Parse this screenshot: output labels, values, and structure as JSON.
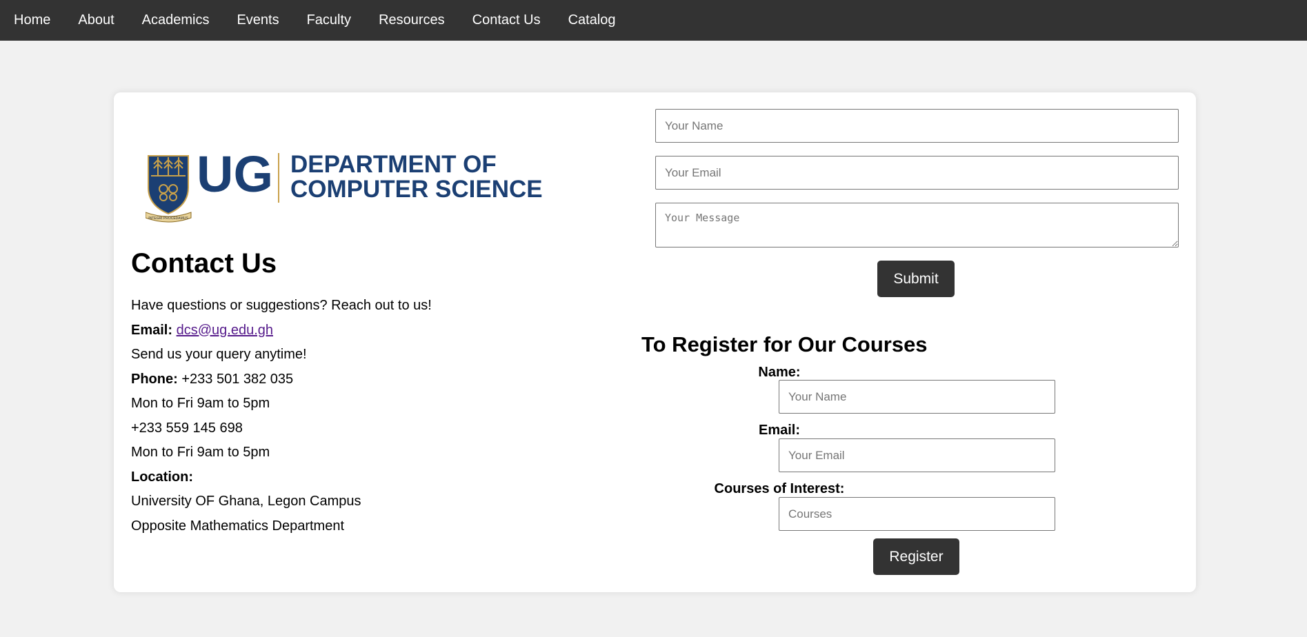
{
  "nav": {
    "items": [
      "Home",
      "About",
      "Academics",
      "Events",
      "Faculty",
      "Resources",
      "Contact Us",
      "Catalog"
    ]
  },
  "logo": {
    "mark": "UG",
    "line1": "DEPARTMENT OF",
    "line2": "COMPUTER SCIENCE",
    "motto": "INTEGRI PROCEDAMUS",
    "brand_color": "#1b3f73",
    "gold_color": "#c9a14a"
  },
  "contact": {
    "title": "Contact Us",
    "intro": "Have questions or suggestions? Reach out to us!",
    "email_label": "Email:",
    "email": "dcs@ug.edu.gh",
    "query": "Send us your query anytime!",
    "phone_label": "Phone:",
    "phone1": "+233 501 382 035",
    "hours1": "Mon to Fri 9am to 5pm",
    "phone2": "+233 559 145 698",
    "hours2": "Mon to Fri 9am to 5pm",
    "location_label": "Location:",
    "location1": "University OF Ghana, Legon Campus",
    "location2": "Opposite Mathematics Department"
  },
  "contact_form": {
    "name_placeholder": "Your Name",
    "email_placeholder": "Your Email",
    "message_placeholder": "Your Message",
    "submit_label": "Submit"
  },
  "register": {
    "title": "To Register for Our Courses",
    "name_label": "Name:",
    "name_placeholder": "Your Name",
    "email_label": "Email:",
    "email_placeholder": "Your Email",
    "courses_label": "Courses of Interest:",
    "courses_placeholder": "Courses",
    "register_label": "Register"
  },
  "colors": {
    "nav_bg": "#333333",
    "page_bg": "#f1f1f1",
    "button_bg": "#333333",
    "link": "#551a8b"
  }
}
